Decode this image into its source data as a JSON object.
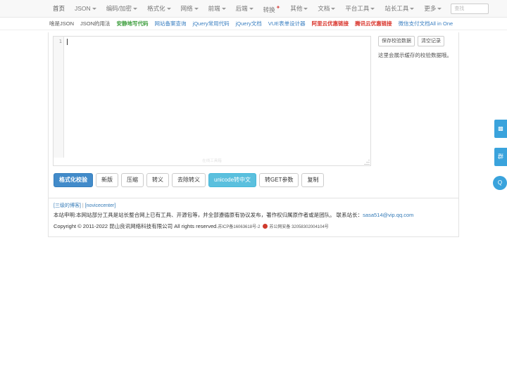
{
  "navbar": {
    "items": [
      {
        "label": "首页",
        "caret": false,
        "hot": false
      },
      {
        "label": "JSON",
        "caret": true,
        "hot": false
      },
      {
        "label": "编码/加密",
        "caret": true,
        "hot": false
      },
      {
        "label": "格式化",
        "caret": true,
        "hot": false
      },
      {
        "label": "网络",
        "caret": true,
        "hot": false
      },
      {
        "label": "前端",
        "caret": true,
        "hot": false
      },
      {
        "label": "后端",
        "caret": true,
        "hot": false
      },
      {
        "label": "转换",
        "caret": false,
        "hot": true
      },
      {
        "label": "其他",
        "caret": true,
        "hot": false
      },
      {
        "label": "文档",
        "caret": true,
        "hot": false
      },
      {
        "label": "平台工具",
        "caret": true,
        "hot": false
      },
      {
        "label": "站长工具",
        "caret": true,
        "hot": false
      },
      {
        "label": "更多",
        "caret": true,
        "hot": false
      }
    ],
    "search_placeholder": "查找"
  },
  "sublinks": [
    {
      "label": "啥是JSON",
      "style": "gray"
    },
    {
      "label": "JSON的用法",
      "style": "gray"
    },
    {
      "label": "安静地写代码",
      "style": "green"
    },
    {
      "label": "网站备案查询",
      "style": "blue"
    },
    {
      "label": "jQuery常用代码",
      "style": "blue"
    },
    {
      "label": "jQuery文档",
      "style": "blue"
    },
    {
      "label": "VUE表单设计器",
      "style": "blue"
    },
    {
      "label": "阿里云优惠链接",
      "style": "red"
    },
    {
      "label": "腾讯云优惠链接",
      "style": "red"
    },
    {
      "label": "微信支付文档All in One",
      "style": "blue"
    }
  ],
  "editor": {
    "line_number": "1",
    "content": "",
    "watermark": "在线工具箱"
  },
  "side_panel": {
    "save_label": "保存校验数据",
    "clear_label": "清空记录",
    "hint": "这里会展示缓存的校验数据哦。"
  },
  "actions": [
    {
      "label": "格式化校验",
      "style": "primary"
    },
    {
      "label": "新版",
      "style": "default"
    },
    {
      "label": "压缩",
      "style": "default"
    },
    {
      "label": "转义",
      "style": "default"
    },
    {
      "label": "去除转义",
      "style": "default"
    },
    {
      "label": "unicode转中文",
      "style": "info"
    },
    {
      "label": "转GET参数",
      "style": "default"
    },
    {
      "label": "复制",
      "style": "default"
    }
  ],
  "footer": {
    "blog_link": "[三级的博客]",
    "separator": "|",
    "novice_link": "[novicecenter]",
    "statement": "本站申明:本网站部分工具是站长整合网上已有工具、开源包等，并全部遵循原有协议发布，著作权归属原作者或是团队。 联系站长：",
    "email": "sasa514@vip.qq.com",
    "copyright": "Copyright © 2011-2022 昆山良讯网络科技有限公司 All rights reserved.",
    "icp": "苏ICP备16063618号-2",
    "police_beian": "苏公网安备 32058302004104号"
  },
  "rail": [
    {
      "icon": "qrcode-icon",
      "glyph": "▩"
    },
    {
      "icon": "group-chat-icon",
      "glyph": "群"
    },
    {
      "icon": "search-icon",
      "glyph": "Q"
    }
  ]
}
